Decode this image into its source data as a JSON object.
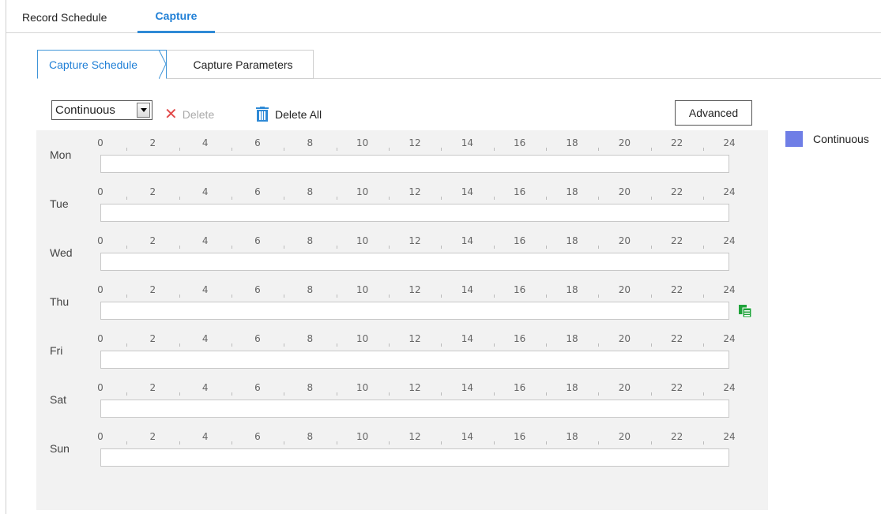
{
  "tabs": {
    "record_schedule": "Record Schedule",
    "capture": "Capture"
  },
  "sub_tabs": {
    "capture_schedule": "Capture Schedule",
    "capture_parameters": "Capture Parameters"
  },
  "toolbar": {
    "type_select_value": "Continuous",
    "delete_label": "Delete",
    "delete_all_label": "Delete All",
    "advanced_label": "Advanced"
  },
  "legend": {
    "label": "Continuous",
    "color": "#6f7ee6"
  },
  "tick_labels": [
    "0",
    "2",
    "4",
    "6",
    "8",
    "10",
    "12",
    "14",
    "16",
    "18",
    "20",
    "22",
    "24"
  ],
  "days": [
    "Mon",
    "Tue",
    "Wed",
    "Thu",
    "Fri",
    "Sat",
    "Sun"
  ],
  "icons": {
    "delete": "close-x-icon",
    "delete_all": "trash-icon",
    "copy": "copy-icon",
    "type_dropdown": "chevron-down-icon"
  },
  "colors": {
    "accent": "#2f8ad6",
    "copy_icon": "#1fa33a",
    "delete_x": "#e24a4a"
  }
}
